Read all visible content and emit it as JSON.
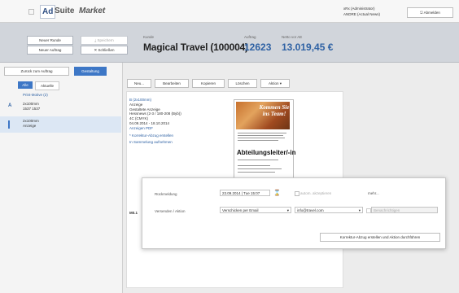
{
  "app": {
    "logo_ad": "Ad",
    "logo_suite": "Suite",
    "logo_market": "Market"
  },
  "user": {
    "name": "xRx (Administrator)",
    "info": "ANDRE (Actual News)",
    "logout": "Abmelden"
  },
  "header": {
    "new_round": "Neuer Runde",
    "new_order": "Neuer Auftrag",
    "save": "Speichern",
    "close": "Schließen",
    "campaign_label": "Kunde",
    "campaign": "Magical Travel (100004)",
    "order_label": "Auftrag",
    "order_number": "12623",
    "amount_label": "Netto vor AE",
    "amount": "13.019,45 €"
  },
  "subnav": {
    "back": "Zurück zum Auftrag",
    "design": "Gestaltung"
  },
  "sidebar": {
    "filter_all": "Alle",
    "filter_current": "Aktuelle",
    "group": "Print-Motive (2)",
    "items": [
      {
        "marker": "A",
        "line1": "2x100mm",
        "line2": "1537 1537"
      },
      {
        "marker": "B",
        "line1": "2x100mm",
        "line2": "Anzeige"
      }
    ]
  },
  "toolbar": {
    "new": "Neu...",
    "edit": "Bearbeiten",
    "copy": "Kopieren",
    "delete": "Löschen",
    "action": "Aktion"
  },
  "detail": {
    "line1": "B (2x100mm)",
    "line2": "Anzeige",
    "line3": "Gestaltete Anzeige",
    "line4": "Hessnews (2-3 / 180-208 (Byb))",
    "line5": "4C (CMYK)",
    "line6": "04.09.2014 - 18.10.2014",
    "pdf_link": "Anzeigen PDF",
    "create_link": "* Korrektur-Abzug erstellen",
    "collect_link": "In Sammelung aufnehmen",
    "footer": "M0.1"
  },
  "ad": {
    "headline": "Kommen Sie ins Team!",
    "title": "Abteilungsleiter/-in"
  },
  "dialog": {
    "deadline_label": "Rückmeldung",
    "deadline_value": "23.09.2014 | Tue 15:07",
    "auto_accept": "autom. akzeptieren",
    "more": "mehr...",
    "send_label": "Versenden / Aktion",
    "send_option": "Verschicken per Email",
    "email": "info@travel.com",
    "cc_placeholder": "Benachrichtigen",
    "submit": "Korrektur-Abzug erstellen und Aktion durchführen"
  }
}
